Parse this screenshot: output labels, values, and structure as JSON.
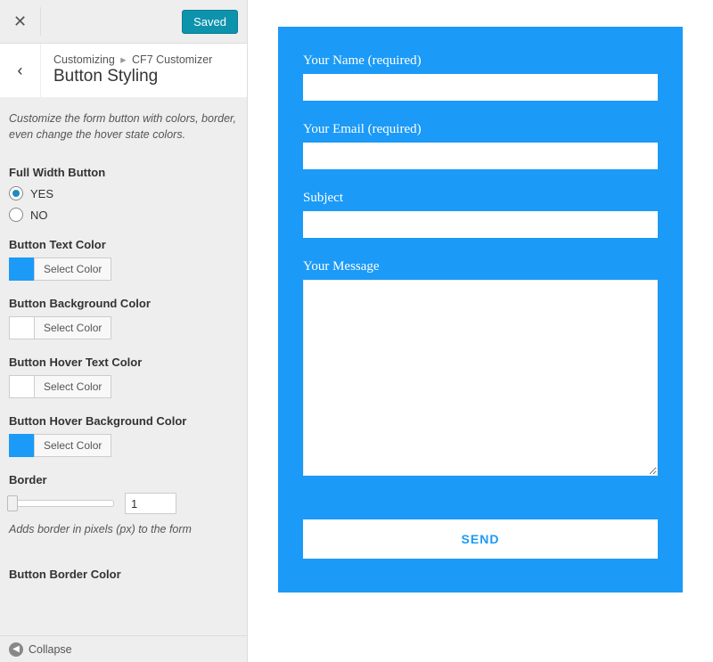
{
  "topbar": {
    "saved_label": "Saved"
  },
  "breadcrumb": {
    "root": "Customizing",
    "section": "CF7 Customizer"
  },
  "panel": {
    "title": "Button Styling",
    "description": "Customize the form button with colors, border, even change the hover state colors."
  },
  "controls": {
    "full_width": {
      "label": "Full Width Button",
      "options": {
        "yes": "YES",
        "no": "NO"
      },
      "value": "YES"
    },
    "text_color": {
      "label": "Button Text Color",
      "swatch": "#1b9af7",
      "button": "Select Color"
    },
    "bg_color": {
      "label": "Button Background Color",
      "swatch": "#ffffff",
      "button": "Select Color"
    },
    "hover_text_color": {
      "label": "Button Hover Text Color",
      "swatch": "#ffffff",
      "button": "Select Color"
    },
    "hover_bg_color": {
      "label": "Button Hover Background Color",
      "swatch": "#1b9af7",
      "button": "Select Color"
    },
    "border": {
      "label": "Border",
      "value": "1",
      "help": "Adds border in pixels (px) to the form"
    },
    "truncated_label": "Button Border Color"
  },
  "collapse_label": "Collapse",
  "form": {
    "name_label": "Your Name (required)",
    "email_label": "Your Email (required)",
    "subject_label": "Subject",
    "message_label": "Your Message",
    "submit_label": "SEND"
  }
}
